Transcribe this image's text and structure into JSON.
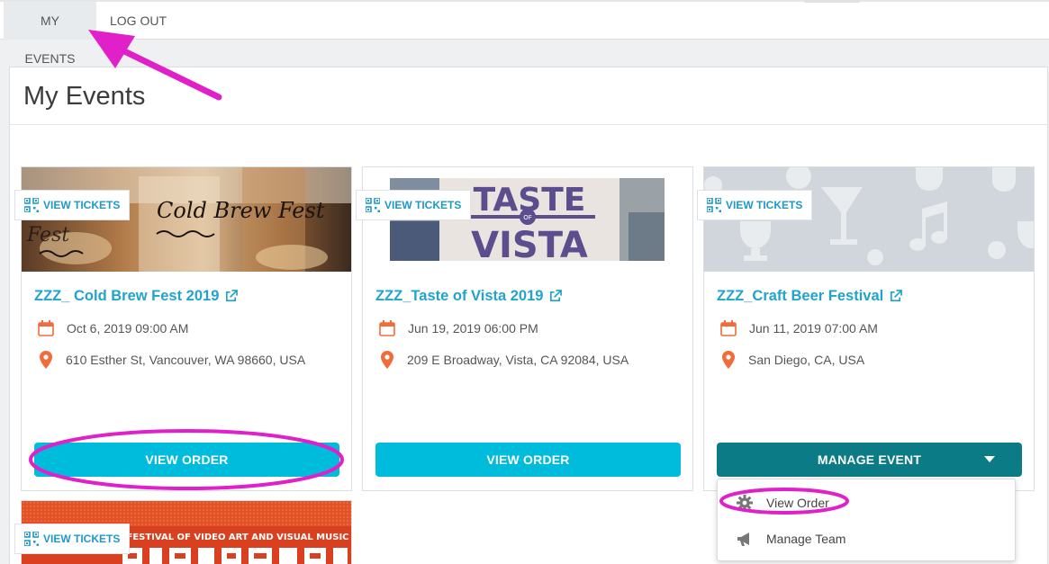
{
  "nav": {
    "my_events": "MY EVENTS",
    "log_out": "LOG OUT"
  },
  "page": {
    "title": "My Events"
  },
  "events": [
    {
      "title": "ZZZ_ Cold Brew Fest 2019",
      "date": "Oct 6, 2019 09:00 AM",
      "location": "610 Esther St, Vancouver, WA 98660, USA",
      "view_tickets": "VIEW TICKETS",
      "action": "VIEW ORDER",
      "banner_text": "Cold Brew Fest"
    },
    {
      "title": "ZZZ_Taste of Vista 2019",
      "date": "Jun 19, 2019 06:00 PM",
      "location": "209 E Broadway, Vista, CA 92084, USA",
      "view_tickets": "VIEW TICKETS",
      "action": "VIEW ORDER",
      "banner_text_1": "TASTE",
      "banner_text_2": "OF",
      "banner_text_3": "VISTA"
    },
    {
      "title": "ZZZ_Craft Beer Festival",
      "date": "Jun 11, 2019 07:00 AM",
      "location": "San Diego, CA, USA",
      "view_tickets": "VIEW TICKETS",
      "action": "MANAGE EVENT"
    },
    {
      "view_tickets": "VIEW TICKETS",
      "banner_text": "FESTIVAL OF VIDEO ART AND VISUAL MUSIC"
    }
  ],
  "dropdown": {
    "view_order": "View Order",
    "manage_team": "Manage Team"
  },
  "colors": {
    "accent_cyan": "#00bcdc",
    "manage_teal": "#0b7b86",
    "link_blue": "#1fa3cf",
    "icon_orange": "#f26b3a",
    "annotation_magenta": "#e020c8"
  },
  "icons": {
    "qr": "qr-code-icon",
    "external": "external-link-icon",
    "calendar": "calendar-icon",
    "pin": "map-pin-icon",
    "gear": "gear-icon",
    "megaphone": "megaphone-icon"
  }
}
